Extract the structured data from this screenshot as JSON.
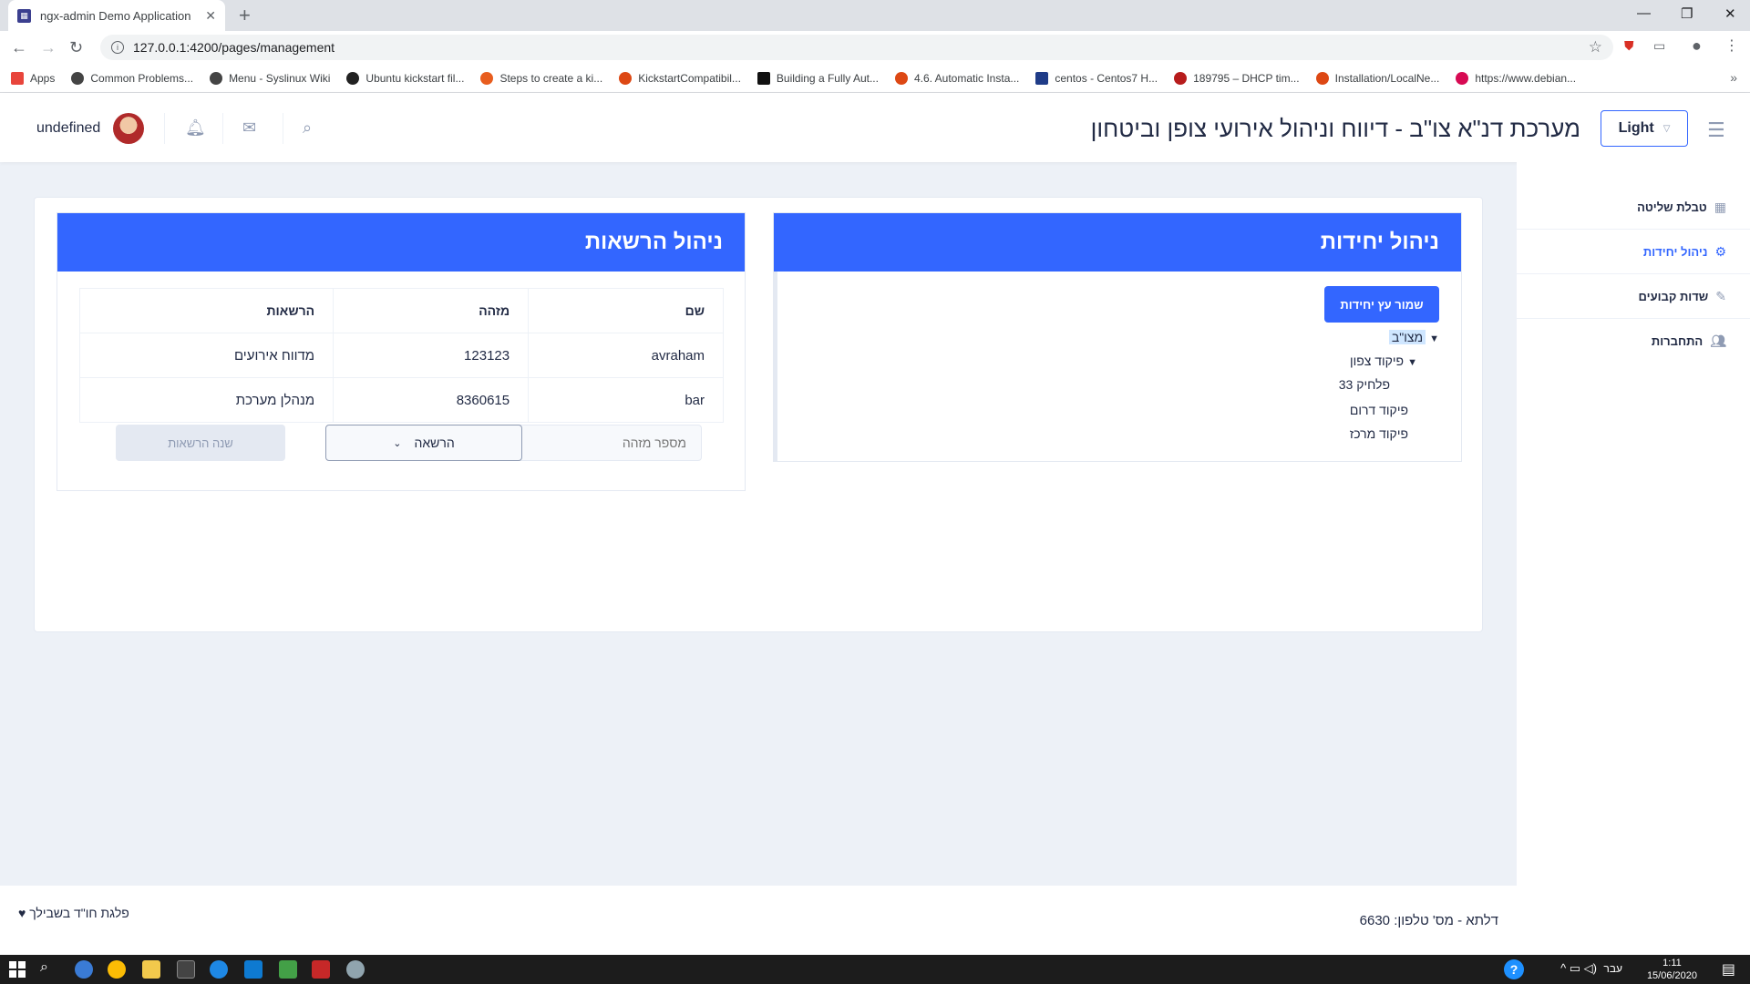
{
  "browser": {
    "tab_title": "ngx-admin Demo Application",
    "url": "127.0.0.1:4200/pages/management",
    "bookmarks": [
      {
        "label": "Apps",
        "color": "#e8453c"
      },
      {
        "label": "Common Problems...",
        "color": "#444444"
      },
      {
        "label": "Menu - Syslinux Wiki",
        "color": "#444444"
      },
      {
        "label": "Ubuntu kickstart fil...",
        "color": "#222222"
      },
      {
        "label": "Steps to create a ki...",
        "color": "#e85d1e"
      },
      {
        "label": "KickstartCompatibil...",
        "color": "#dd4814"
      },
      {
        "label": "Building a Fully Aut...",
        "color": "#111111"
      },
      {
        "label": "4.6. Automatic Insta...",
        "color": "#dd4814"
      },
      {
        "label": "centos - Centos7 H...",
        "color": "#1f3c88"
      },
      {
        "label": "189795 – DHCP tim...",
        "color": "#b71c1c"
      },
      {
        "label": "Installation/LocalNe...",
        "color": "#dd4814"
      },
      {
        "label": "https://www.debian...",
        "color": "#d70a53"
      }
    ]
  },
  "header": {
    "user_name": "undefined",
    "title": "מערכת דנ\"א צו\"ב - דיווח וניהול אירועי צופן וביטחון",
    "theme": "Light"
  },
  "sidebar": {
    "items": [
      {
        "label": "טבלת שליטה",
        "icon": "table-icon",
        "active": false
      },
      {
        "label": "ניהול יחידות",
        "icon": "gear-icon",
        "active": true
      },
      {
        "label": "שדות קבועים",
        "icon": "pencil-icon",
        "active": false
      },
      {
        "label": "התחברות",
        "icon": "people-icon",
        "active": false
      }
    ]
  },
  "units": {
    "title": "ניהול יחידות",
    "save_button": "שמור עץ יחידות",
    "tree": {
      "root": "מצו\"ב",
      "north": "פיקוד צפון",
      "platoon": "פלחיק 33",
      "south": "פיקוד דרום",
      "center": "פיקוד מרכז"
    }
  },
  "permissions": {
    "title": "ניהול הרשאות",
    "columns": [
      "שם",
      "מזהה",
      "הרשאות"
    ],
    "rows": [
      [
        "avraham",
        "123123",
        "מדווח אירועים"
      ],
      [
        "bar",
        "8360615",
        "מנהלן מערכת"
      ]
    ],
    "id_placeholder": "מספר מזהה",
    "select_value": "הרשאה",
    "change_button": "שנה הרשאות"
  },
  "footer": {
    "left": "פלגת חו\"ד בשבילך ♥",
    "right": "דלתא - מס' טלפון: 6630"
  },
  "taskbar": {
    "lang": "עבר",
    "time": "1:11",
    "date": "15/06/2020"
  }
}
